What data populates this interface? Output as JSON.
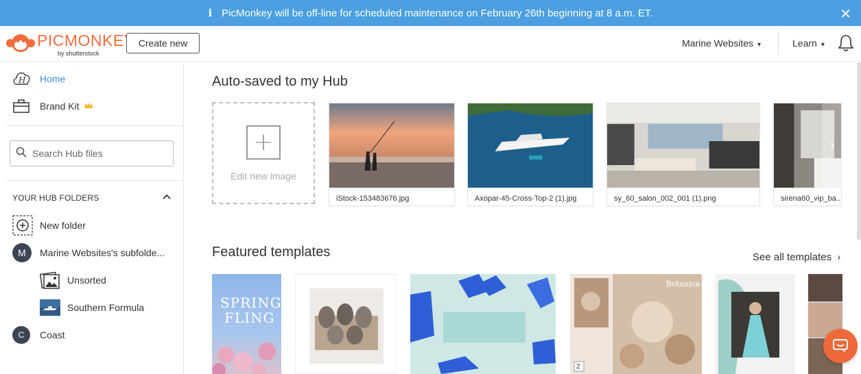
{
  "banner": {
    "info_glyph": "i",
    "message": "PicMonkey will be off-line for scheduled maintenance on February 26th beginning at 8 a.m. ET.",
    "close_glyph": "✕"
  },
  "header": {
    "logo_text": "PICMONKEY",
    "logo_sub": "by shutterstock",
    "create_new": "Create new",
    "account": "Marine Websites",
    "learn": "Learn",
    "chevron": "⌄"
  },
  "sidebar": {
    "home": "Home",
    "brand_kit": "Brand Kit",
    "search_placeholder": "Search Hub files",
    "folders_header": "YOUR HUB FOLDERS",
    "new_folder": "New folder",
    "subfolders": "Marine Websites's subfolde...",
    "subfolders_initial": "M",
    "unsorted": "Unsorted",
    "southern_formula": "Southern Formula",
    "coast": "Coast",
    "coast_initial": "C"
  },
  "main": {
    "autosaved_title": "Auto-saved to my Hub",
    "edit_new": "Edit new image",
    "files": [
      {
        "name": "iStock-153483676.jpg"
      },
      {
        "name": "Axopar-45-Cross-Top-2 (1).jpg"
      },
      {
        "name": "sy_60_salon_002_001 (1).png"
      },
      {
        "name": "sirena60_vip_ba..."
      }
    ],
    "featured_title": "Featured templates",
    "see_all": "See all templates",
    "see_all_arrow": "›",
    "next_arrow": "›",
    "template_texts": {
      "spring": "SPRING",
      "fling": "FLING",
      "botanica": "Botanica",
      "page_badge": "2"
    }
  },
  "colors": {
    "banner": "#4b9fe0",
    "brand_orange": "#f26c3d",
    "link_blue": "#3b8fd6",
    "chat": "#ef6a3a"
  }
}
